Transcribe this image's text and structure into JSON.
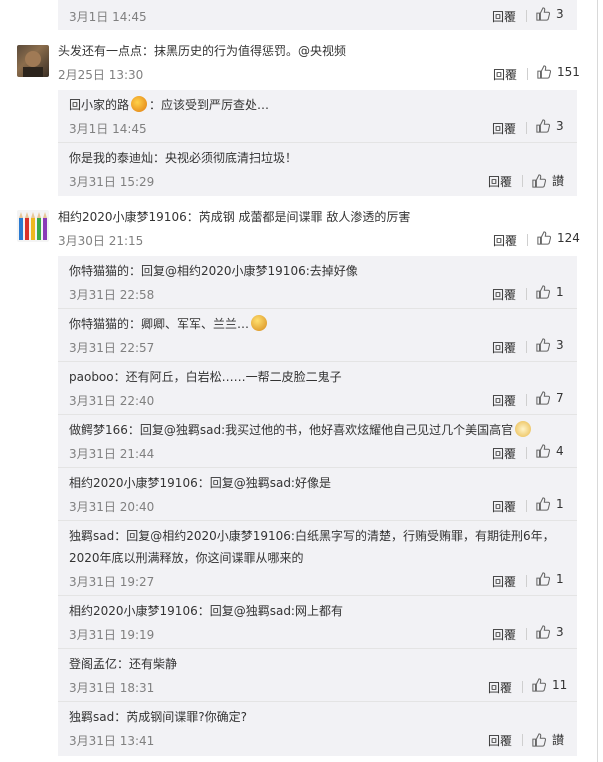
{
  "c0_sub1": {
    "time": "3月1日 14:45",
    "reply": "回覆",
    "likes": "3"
  },
  "c1": {
    "text": "头发还有一点点：抹黑历史的行为值得惩罚。@央视频",
    "time": "2月25日 13:30",
    "reply": "回覆",
    "likes": "151",
    "subs": [
      {
        "name": "回小家的路",
        "text": "：应该受到严厉查处…",
        "time": "3月1日 14:45",
        "reply": "回覆",
        "likes": "3"
      },
      {
        "name": "你是我的泰迪灿",
        "text": "：央视必须彻底清扫垃圾！",
        "time": "3月31日 15:29",
        "reply": "回覆",
        "likes": "讃"
      }
    ]
  },
  "c2": {
    "text": "相约2020小康梦19106：芮成钢 成蕾都是间谍罪 敌人渗透的厉害",
    "time": "3月30日 21:15",
    "reply": "回覆",
    "likes": "124",
    "subs": [
      {
        "text": "你特猫猫的：回复@相约2020小康梦19106:去掉好像",
        "time": "3月31日 22:58",
        "reply": "回覆",
        "likes": "1"
      },
      {
        "text": "你特猫猫的：卿卿、军军、兰兰…",
        "time": "3月31日 22:57",
        "reply": "回覆",
        "likes": "3"
      },
      {
        "text": "paoboo：还有阿丘，白岩松……一帮二皮脸二鬼子",
        "time": "3月31日 22:40",
        "reply": "回覆",
        "likes": "7"
      },
      {
        "text": "做鳄梦166：回复@独羁sad:我买过他的书，他好喜欢炫耀他自己见过几个美国高官",
        "time": "3月31日 21:44",
        "reply": "回覆",
        "likes": "4"
      },
      {
        "text": "相约2020小康梦19106：回复@独羁sad:好像是",
        "time": "3月31日 20:40",
        "reply": "回覆",
        "likes": "1"
      },
      {
        "text": "独羁sad：回复@相约2020小康梦19106:白纸黑字写的清楚，行贿受贿罪，有期徒刑6年，",
        "text2": "2020年底以刑满释放，你这间谍罪从哪来的",
        "time": "3月31日 19:27",
        "reply": "回覆",
        "likes": "1"
      },
      {
        "text": "相约2020小康梦19106：回复@独羁sad:网上都有",
        "time": "3月31日 19:19",
        "reply": "回覆",
        "likes": "3"
      },
      {
        "text": "登阁孟亿：还有柴静",
        "time": "3月31日 18:31",
        "reply": "回覆",
        "likes": "11"
      },
      {
        "text": "独羁sad：芮成钢间谍罪?你确定?",
        "time": "3月31日 13:41",
        "reply": "回覆",
        "likes": "讃"
      }
    ]
  }
}
